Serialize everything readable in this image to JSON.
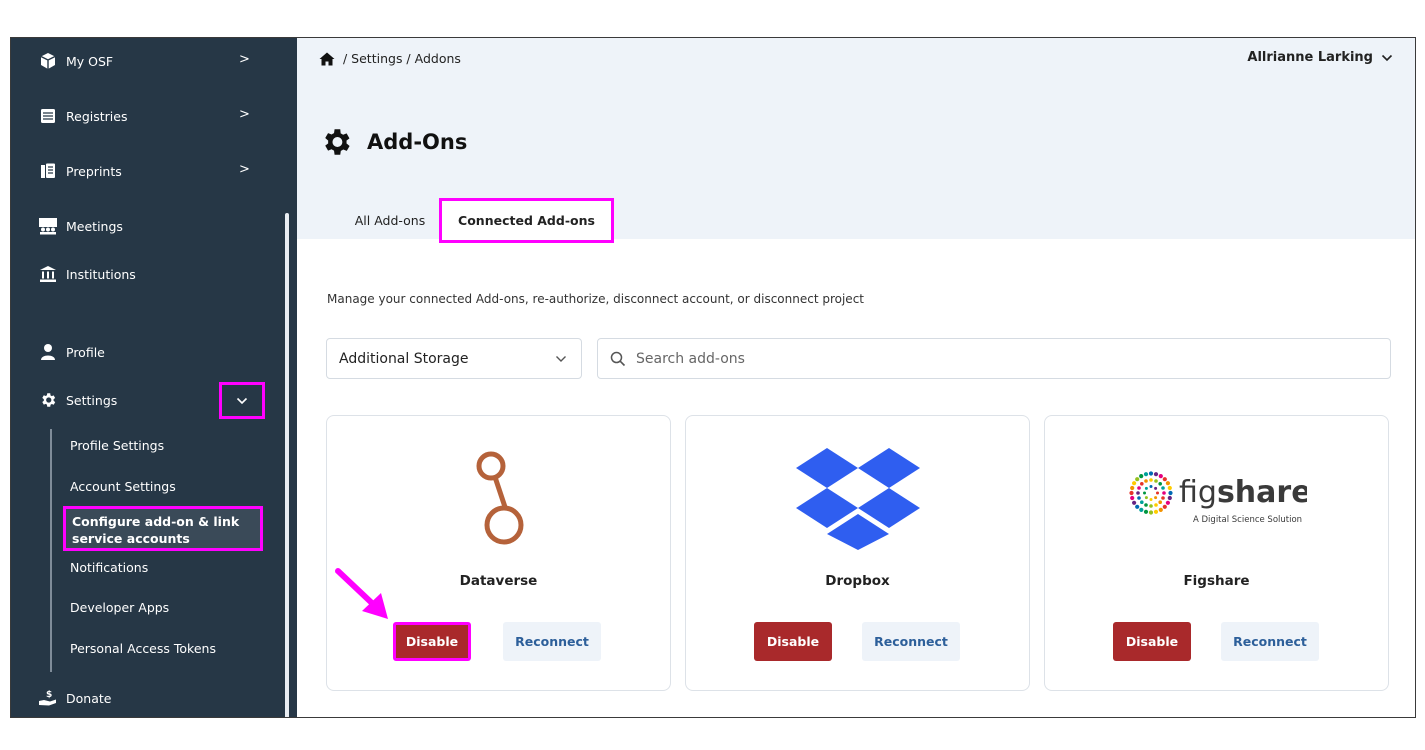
{
  "sidebar": {
    "items": [
      {
        "label": "My OSF",
        "icon": "cube-icon"
      },
      {
        "label": "Registries",
        "icon": "registries-icon"
      },
      {
        "label": "Preprints",
        "icon": "preprints-icon"
      },
      {
        "label": "Meetings",
        "icon": "meetings-icon"
      },
      {
        "label": "Institutions",
        "icon": "institution-icon"
      },
      {
        "label": "Profile",
        "icon": "user-icon"
      },
      {
        "label": "Settings",
        "icon": "gear-icon"
      },
      {
        "label": "Donate",
        "icon": "donate-icon"
      }
    ],
    "settings_sub": [
      {
        "label": "Profile Settings"
      },
      {
        "label": "Account Settings"
      },
      {
        "label": "Configure add-on & link service accounts"
      },
      {
        "label": "Notifications"
      },
      {
        "label": "Developer Apps"
      },
      {
        "label": "Personal Access Tokens"
      }
    ]
  },
  "header": {
    "breadcrumb": "/ Settings / Addons",
    "user_name": "Allrianne Larking",
    "page_title": "Add-Ons"
  },
  "tabs": [
    {
      "label": "All Add-ons",
      "active": false
    },
    {
      "label": "Connected Add-ons",
      "active": true
    }
  ],
  "main": {
    "intro": "Manage your connected Add-ons, re-authorize, disconnect account, or disconnect project",
    "filter_value": "Additional Storage",
    "search_placeholder": "Search add-ons"
  },
  "cards": [
    {
      "name": "Dataverse",
      "disable_label": "Disable",
      "reconnect_label": "Reconnect",
      "logo": "dataverse-logo"
    },
    {
      "name": "Dropbox",
      "disable_label": "Disable",
      "reconnect_label": "Reconnect",
      "logo": "dropbox-logo"
    },
    {
      "name": "Figshare",
      "disable_label": "Disable",
      "reconnect_label": "Reconnect",
      "logo": "figshare-logo",
      "logo_text_a": "fig",
      "logo_text_b": "share",
      "logo_tagline": "A Digital Science Solution"
    }
  ],
  "colors": {
    "sidebar_bg": "#263746",
    "header_bg": "#eef3f9",
    "highlight": "#ff00ff",
    "disable_btn": "#a9292b",
    "reconnect_text": "#2d5f9a",
    "dataverse": "#b5623a",
    "dropbox": "#2f5ef0"
  }
}
